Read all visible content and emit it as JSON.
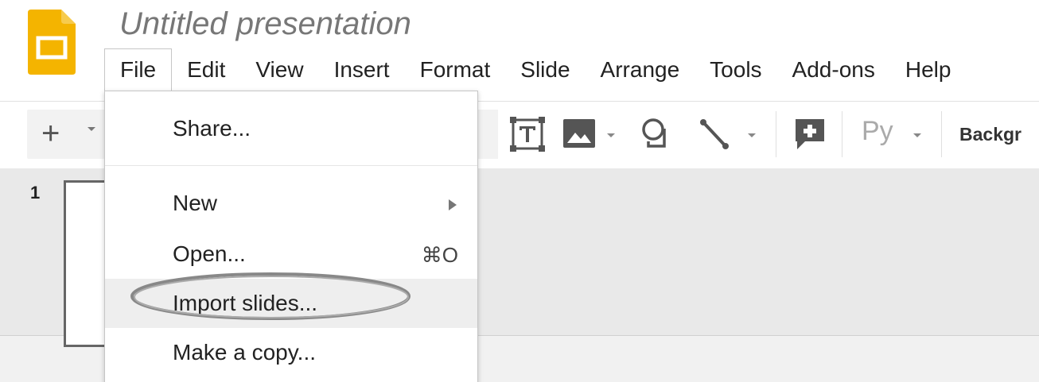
{
  "doc": {
    "title": "Untitled presentation"
  },
  "colors": {
    "logo_yellow": "#f4b400",
    "logo_fold": "#f7cb4d",
    "highlight": "#eeeeee",
    "annotation": "#888888"
  },
  "menubar": {
    "items": [
      {
        "label": "File"
      },
      {
        "label": "Edit"
      },
      {
        "label": "View"
      },
      {
        "label": "Insert"
      },
      {
        "label": "Format"
      },
      {
        "label": "Slide"
      },
      {
        "label": "Arrange"
      },
      {
        "label": "Tools"
      },
      {
        "label": "Add-ons"
      },
      {
        "label": "Help"
      }
    ]
  },
  "toolbar": {
    "plus_label": "+",
    "font_label": "Py",
    "background_label": "Backgr",
    "icons": [
      "new-slide-icon",
      "textbox-icon",
      "image-icon",
      "shape-icon",
      "line-icon",
      "comment-icon"
    ]
  },
  "filmstrip": {
    "slide_number": "1"
  },
  "file_menu": {
    "items": [
      {
        "label": "Share..."
      },
      {
        "label": "New",
        "submenu": true
      },
      {
        "label": "Open...",
        "shortcut": "⌘O"
      },
      {
        "label": "Import slides...",
        "highlighted": true
      },
      {
        "label": "Make a copy..."
      }
    ]
  }
}
